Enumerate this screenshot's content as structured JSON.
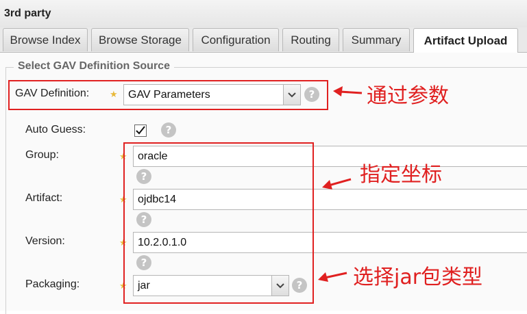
{
  "window": {
    "title": "3rd party"
  },
  "tabs": [
    {
      "label": "Browse Index"
    },
    {
      "label": "Browse Storage"
    },
    {
      "label": "Configuration"
    },
    {
      "label": "Routing"
    },
    {
      "label": "Summary"
    },
    {
      "label": "Artifact Upload",
      "active": true
    }
  ],
  "form": {
    "legend": "Select GAV Definition Source",
    "gav_definition": {
      "label": "GAV Definition:",
      "value": "GAV Parameters"
    },
    "auto_guess": {
      "label": "Auto Guess:",
      "checked": true
    },
    "group": {
      "label": "Group:",
      "value": "oracle"
    },
    "artifact": {
      "label": "Artifact:",
      "value": "ojdbc14"
    },
    "version": {
      "label": "Version:",
      "value": "10.2.0.1.0"
    },
    "packaging": {
      "label": "Packaging:",
      "value": "jar"
    }
  },
  "annotations": {
    "a1": "通过参数",
    "a2": "指定坐标",
    "a3": "选择jar包类型"
  },
  "colors": {
    "annotation": "#e02020",
    "required_star": "#e8b93a",
    "help_icon": "#c4c4c4"
  },
  "icons": {
    "help": "question-circle-icon",
    "required": "star-icon",
    "dropdown": "chevron-down-icon"
  }
}
